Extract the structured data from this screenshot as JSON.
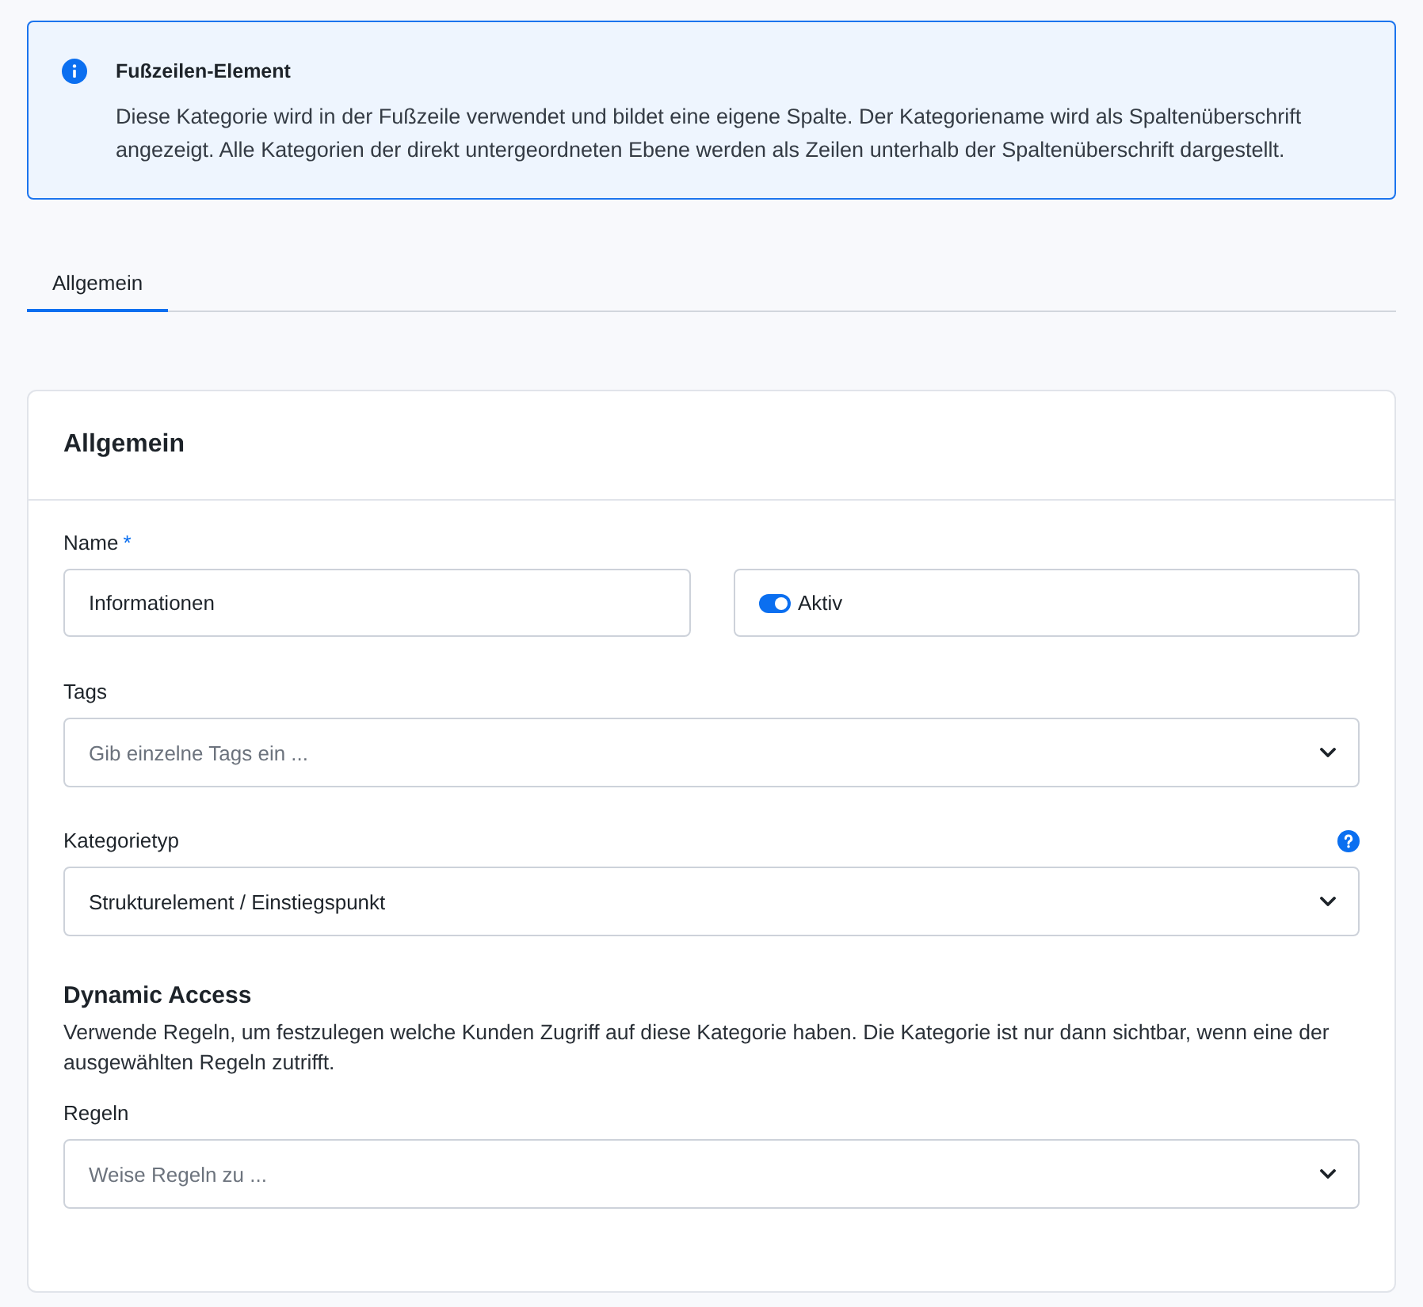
{
  "alert": {
    "title": "Fußzeilen-Element",
    "text": "Diese Kategorie wird in der Fußzeile verwendet und bildet eine eigene Spalte. Der Kategoriename wird als Spaltenüberschrift angezeigt. Alle Kategorien der direkt untergeordneten Ebene werden als Zeilen unterhalb der Spaltenüberschrift dargestellt."
  },
  "tabs": [
    {
      "label": "Allgemein",
      "selected": true
    }
  ],
  "form": {
    "title": "Allgemein",
    "name_field": {
      "label": "Name",
      "required_mark": "*",
      "value": "Informationen"
    },
    "active_toggle": {
      "label": "Aktiv",
      "on": true
    },
    "tags_field": {
      "label": "Tags",
      "placeholder": "Gib einzelne Tags ein ..."
    },
    "category_type_field": {
      "label": "Kategorietyp",
      "value": "Strukturelement / Einstiegspunkt",
      "help": true
    },
    "dynamic_access": {
      "heading": "Dynamic Access",
      "description": "Verwende Regeln, um festzulegen welche Kunden Zugriff auf diese Kategorie haben. Die Kategorie ist nur dann sichtbar, wenn eine der ausgewählten Regeln zutrifft.",
      "rules_field": {
        "label": "Regeln",
        "placeholder": "Weise Regeln zu ..."
      }
    }
  }
}
